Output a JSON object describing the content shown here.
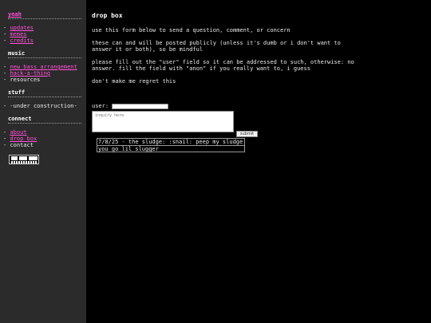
{
  "sidebar": {
    "sections": [
      {
        "title": "yeah",
        "items": [
          {
            "label": "updates",
            "link": true
          },
          {
            "label": "memes",
            "link": true
          },
          {
            "label": "credits",
            "link": true
          }
        ]
      },
      {
        "title": "music",
        "items": [
          {
            "label": "new bass arrangement",
            "link": true
          },
          {
            "label": "hack-a-thing",
            "link": true
          },
          {
            "label": "resources",
            "link": false
          }
        ]
      },
      {
        "title": "stuff",
        "items": [
          {
            "label": "-under construction-",
            "link": false
          }
        ]
      },
      {
        "title": "connect",
        "items": [
          {
            "label": "about",
            "link": true
          },
          {
            "label": "drop box",
            "link": true
          },
          {
            "label": "contact",
            "link": false
          }
        ]
      }
    ],
    "badge_text": "NOISE"
  },
  "main": {
    "title": "drop box",
    "paragraphs": [
      "use this form below to send a question, comment, or concern",
      "these can and will be posted publicly (unless it's dumb or i don't want to\nanswer it or both), so be mindful",
      "please fill out the \"user\" field so it can be addressed to such, otherwise: no\nanswer. fill the field with \"anon\" if you really want to, i guess",
      "don't make me regret this"
    ],
    "form": {
      "user_label": "user:",
      "user_value": "",
      "message_placeholder": "inquiry here",
      "submit_label": "submit"
    },
    "replies": [
      {
        "question": "7/8/25 - the sludge: :snail: peep my sludge",
        "answer": "you go lil slugger"
      }
    ]
  }
}
